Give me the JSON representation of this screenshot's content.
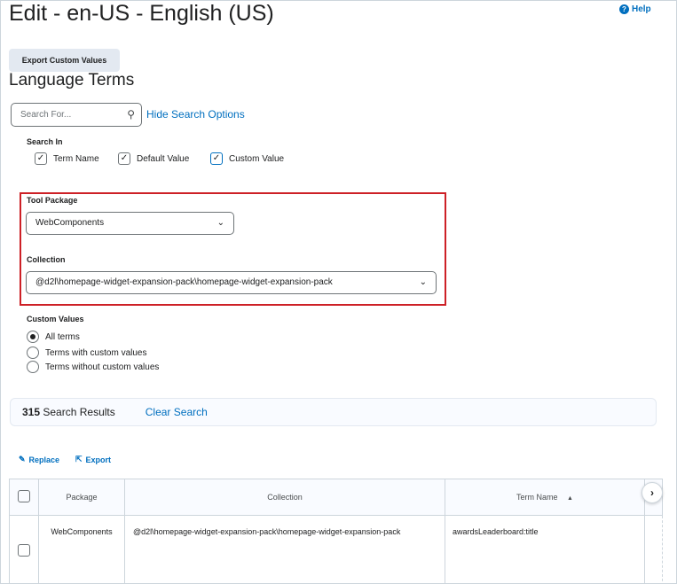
{
  "header": {
    "title": "Edit - en-US - English (US)",
    "help": "Help",
    "export_custom_values": "Export Custom Values",
    "section_title": "Language Terms"
  },
  "search": {
    "placeholder": "Search For...",
    "hide_options": "Hide Search Options"
  },
  "search_in": {
    "label": "Search In",
    "options": [
      {
        "label": "Term Name",
        "checked": true
      },
      {
        "label": "Default Value",
        "checked": true
      },
      {
        "label": "Custom Value",
        "checked": true
      }
    ]
  },
  "tool_package": {
    "label": "Tool Package",
    "value": "WebComponents"
  },
  "collection": {
    "label": "Collection",
    "value": "@d2l\\homepage-widget-expansion-pack\\homepage-widget-expansion-pack"
  },
  "custom_values": {
    "label": "Custom Values",
    "options": [
      {
        "label": "All terms",
        "selected": true
      },
      {
        "label": "Terms with custom values",
        "selected": false
      },
      {
        "label": "Terms without custom values",
        "selected": false
      }
    ]
  },
  "results": {
    "count": "315",
    "label": "Search Results",
    "clear": "Clear Search"
  },
  "actions": {
    "replace": "Replace",
    "export": "Export"
  },
  "table": {
    "headers": [
      "Package",
      "Collection",
      "Term Name"
    ],
    "rows": [
      {
        "package": "WebComponents",
        "collection": "@d2l\\homepage-widget-expansion-pack\\homepage-widget-expansion-pack",
        "term_name": "awardsLeaderboard:title"
      }
    ]
  },
  "colors": {
    "accent": "#006fbf",
    "highlight_border": "#cd2026"
  }
}
